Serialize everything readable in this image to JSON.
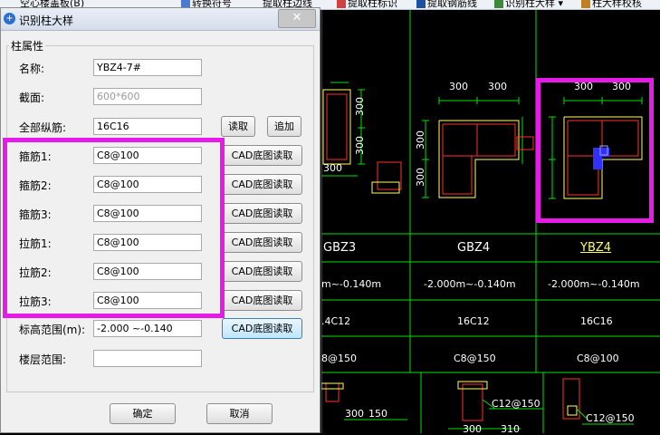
{
  "toolbar": {
    "items": [
      "空心楼盖板(B)",
      "转换符号",
      "提取柱边线",
      "提取柱标识",
      "提取钢筋线",
      "识别柱大样 ▾",
      "柱大样校核"
    ]
  },
  "dialog": {
    "title": "识别柱大样",
    "close_label": "✕",
    "group_title": "柱属性",
    "fields": {
      "name": {
        "label": "名称:",
        "value": "YBZ4-7#"
      },
      "section": {
        "label": "截面:",
        "value": "600*600"
      },
      "all_long_bars": {
        "label": "全部纵筋:",
        "value": "16C16"
      },
      "stirrup1": {
        "label": "箍筋1:",
        "value": "C8@100"
      },
      "stirrup2": {
        "label": "箍筋2:",
        "value": "C8@100"
      },
      "stirrup3": {
        "label": "箍筋3:",
        "value": "C8@100"
      },
      "tie1": {
        "label": "拉筋1:",
        "value": "C8@100"
      },
      "tie2": {
        "label": "拉筋2:",
        "value": "C8@100"
      },
      "tie3": {
        "label": "拉筋3:",
        "value": "C8@100"
      },
      "elevation": {
        "label": "标高范围(m):",
        "value": "-2.000 ~-0.140"
      },
      "floors": {
        "label": "楼层范围:",
        "value": ""
      }
    },
    "buttons": {
      "read": "读取",
      "append": "追加",
      "cad_read": "CAD底图读取",
      "ok": "确定",
      "cancel": "取消"
    }
  },
  "cad": {
    "dims": {
      "d300_a": "300",
      "d300_b": "300",
      "d300_c": "300",
      "d300_d": "300",
      "d300_left_v1": "300",
      "d300_left_v2": "300",
      "d300_left_b": "300",
      "d300_mid_v1": "300",
      "d300_mid_v2": "300",
      "d300_bot1": "300",
      "d150_bot": "150",
      "d300_bot2": "300",
      "d310_bot": "310"
    },
    "table": {
      "names": [
        "GBZ3",
        "GBZ4",
        "YBZ4"
      ],
      "elevations": [
        "m~-0.140m",
        "-2.000m~-0.140m",
        "-2.000m~-0.140m"
      ],
      "long_bars": [
        ".4C12",
        "16C12",
        "16C16"
      ],
      "stirrups": [
        "8@150",
        "C8@150",
        "C8@100"
      ]
    },
    "annotations": {
      "c12_a": "C12@150",
      "c12_b": "C12@150"
    },
    "colors": {
      "line": "#00e000",
      "rebar": "#ff3030",
      "dim": "#ffffff",
      "highlight": "#e81ae8",
      "selection": "#3030ff"
    }
  }
}
